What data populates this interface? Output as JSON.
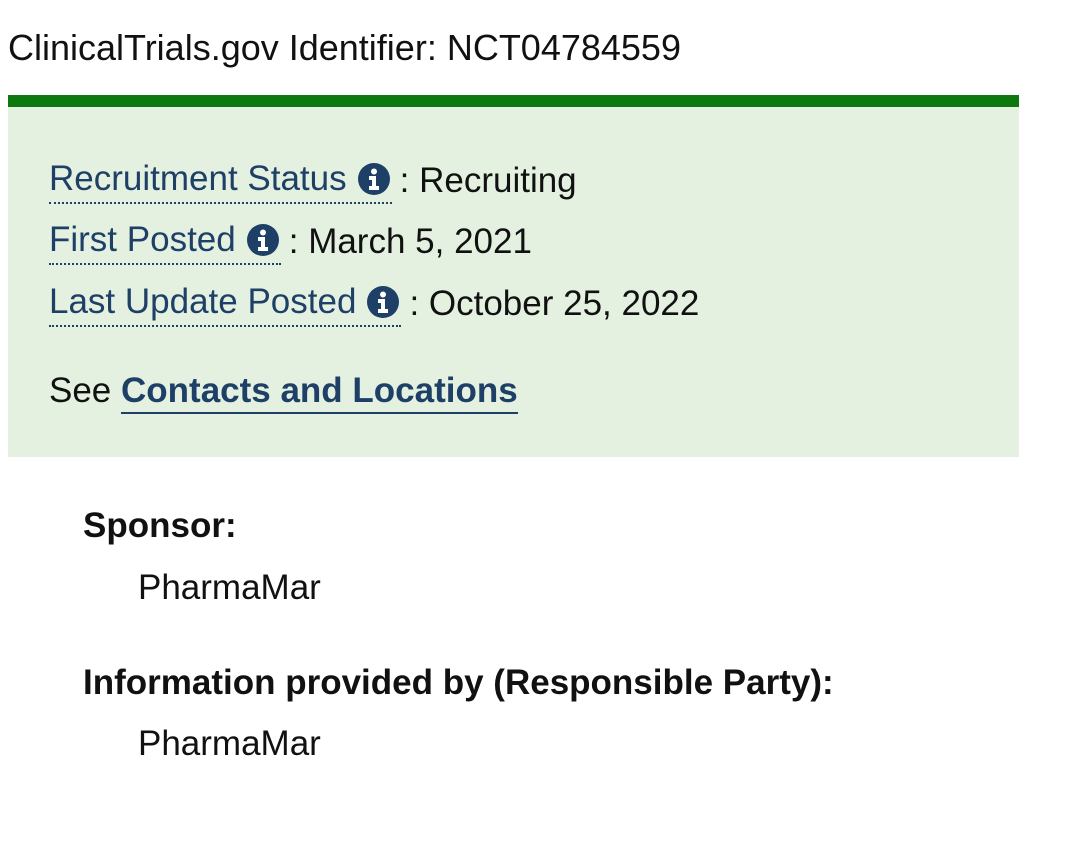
{
  "identifier": {
    "text": "ClinicalTrials.gov Identifier: NCT04784559"
  },
  "status": {
    "rows": [
      {
        "label": "Recruitment Status",
        "separator": ":",
        "value": "Recruiting",
        "icon": "info-icon"
      },
      {
        "label": "First Posted",
        "separator": ":",
        "value": "March 5, 2021",
        "icon": "info-icon"
      },
      {
        "label": "Last Update Posted",
        "separator": ":",
        "value": "October 25, 2022",
        "icon": "info-icon"
      }
    ],
    "see_prefix": "See",
    "see_link": "Contacts and Locations"
  },
  "sponsor": {
    "label": "Sponsor:",
    "value": "PharmaMar"
  },
  "responsible_party": {
    "label": "Information provided by (Responsible Party):",
    "value": "PharmaMar"
  },
  "colors": {
    "accent_bar": "#0d780d",
    "box_background": "#e4f1e1",
    "link": "#1e3f66"
  }
}
